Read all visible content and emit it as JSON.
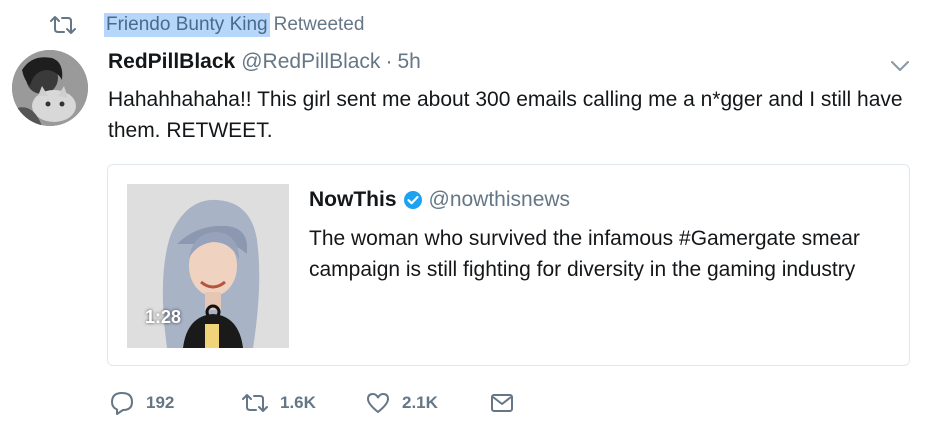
{
  "retweet_context": {
    "icon": "retweet-icon",
    "name": "Friendo Bunty King",
    "suffix": "Retweeted"
  },
  "tweet": {
    "name": "RedPillBlack",
    "handle": "@RedPillBlack",
    "separator": "·",
    "time": "5h",
    "text": "Hahahhahaha!! This girl sent me about 300 emails calling me a n*gger and I still have them. RETWEET."
  },
  "quoted_tweet": {
    "name": "NowThis",
    "handle": "@nowthisnews",
    "verified": true,
    "text": "The woman who survived the infamous #Gamergate smear campaign is still fighting for diversity in the gaming industry",
    "video_duration": "1:28"
  },
  "actions": {
    "replies": "192",
    "retweets": "1.6K",
    "likes": "2.1K"
  },
  "colors": {
    "text": "#14171a",
    "secondary": "#657786",
    "border": "#e1e8ed",
    "verified": "#1da1f2",
    "highlight": "#b6d7fb"
  }
}
